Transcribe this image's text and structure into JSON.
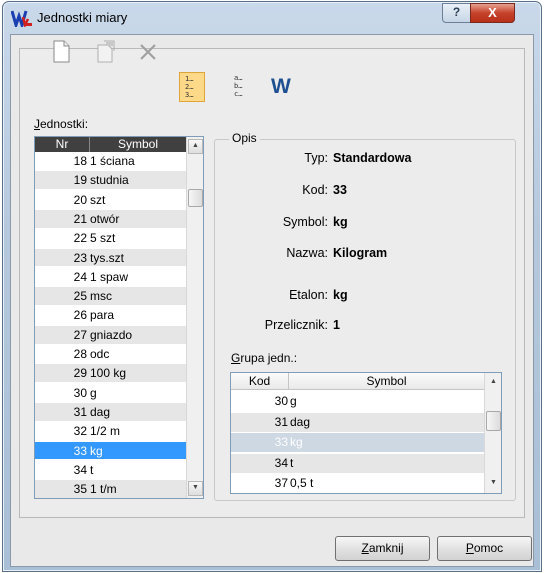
{
  "window": {
    "title": "Jednostki miary",
    "help_symbol": "?",
    "close_symbol": "X"
  },
  "toolbar": {
    "icons": [
      "new-document-icon",
      "edit-document-icon",
      "delete-icon",
      "sort-numeric-icon",
      "sort-alpha-icon",
      "word-icon"
    ],
    "sort_numeric_text": "1…2…3…",
    "sort_alpha_text": "a…b…c…",
    "word_text": "W"
  },
  "jednostki": {
    "label_prefix": "",
    "label_underlined": "J",
    "label_rest": "ednostki:",
    "col_nr": "Nr",
    "col_symbol": "Symbol",
    "rows": [
      {
        "nr": "18",
        "symbol": "1 ściana"
      },
      {
        "nr": "19",
        "symbol": "studnia"
      },
      {
        "nr": "20",
        "symbol": "szt"
      },
      {
        "nr": "21",
        "symbol": "otwór"
      },
      {
        "nr": "22",
        "symbol": "5 szt"
      },
      {
        "nr": "23",
        "symbol": "tys.szt"
      },
      {
        "nr": "24",
        "symbol": "1 spaw"
      },
      {
        "nr": "25",
        "symbol": "msc"
      },
      {
        "nr": "26",
        "symbol": "para"
      },
      {
        "nr": "27",
        "symbol": "gniazdo"
      },
      {
        "nr": "28",
        "symbol": "odc"
      },
      {
        "nr": "29",
        "symbol": "100 kg"
      },
      {
        "nr": "30",
        "symbol": "g"
      },
      {
        "nr": "31",
        "symbol": "dag"
      },
      {
        "nr": "32",
        "symbol": "1/2 m"
      },
      {
        "nr": "33",
        "symbol": "kg"
      },
      {
        "nr": "34",
        "symbol": "t"
      },
      {
        "nr": "35",
        "symbol": "1 t/m"
      }
    ],
    "selected_index": 15
  },
  "opis": {
    "legend": "Opis",
    "typ_label": "Typ:",
    "typ_value": "Standardowa",
    "kod_label": "Kod:",
    "kod_value": "33",
    "symbol_label": "Symbol:",
    "symbol_value": "kg",
    "nazwa_label": "Nazwa:",
    "nazwa_value": "Kilogram",
    "etalon_label": "Etalon:",
    "etalon_value": "kg",
    "przelicznik_label": "Przelicznik:",
    "przelicznik_value": "1",
    "grupa_label_underlined": "G",
    "grupa_label_rest": "rupa jedn.:"
  },
  "grupa": {
    "col_kod": "Kod",
    "col_symbol": "Symbol",
    "rows": [
      {
        "kod": "30",
        "symbol": "g"
      },
      {
        "kod": "31",
        "symbol": "dag"
      },
      {
        "kod": "33",
        "symbol": "kg"
      },
      {
        "kod": "34",
        "symbol": "t"
      },
      {
        "kod": "37",
        "symbol": "0,5 t"
      }
    ],
    "selected_index": 2
  },
  "buttons": {
    "zamknij_underlined": "Z",
    "zamknij_rest": "amknij",
    "pomoc_underlined": "P",
    "pomoc_rest": "omoc"
  }
}
